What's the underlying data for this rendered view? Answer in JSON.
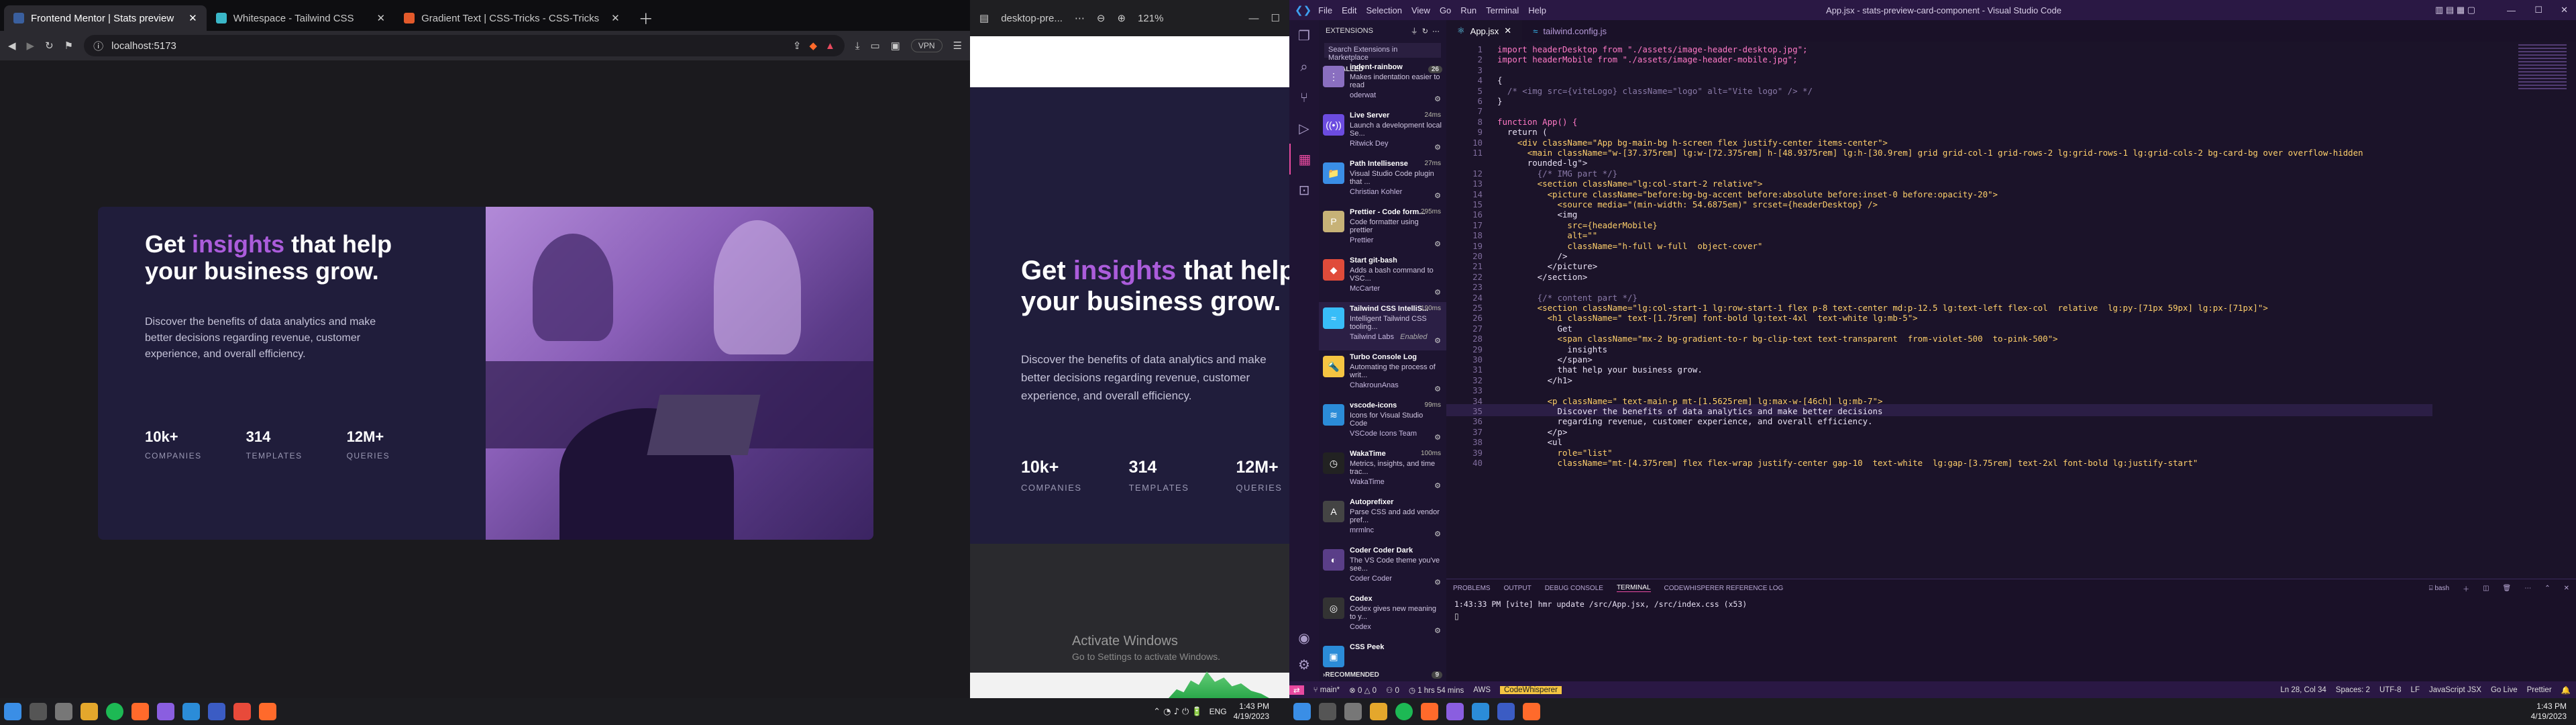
{
  "browser": {
    "tabs": [
      {
        "label": "Frontend Mentor | Stats preview"
      },
      {
        "label": "Whitespace - Tailwind CSS"
      },
      {
        "label": "Gradient Text | CSS-Tricks - CSS-Tricks"
      }
    ],
    "url": "localhost:5173",
    "vpn": "VPN"
  },
  "card_desktop": {
    "title_pre": "Get",
    "title_hl": "insights",
    "title_post": "that help your business grow.",
    "desc": "Discover the benefits of data analytics and make better decisions regarding revenue, customer experience, and overall efficiency.",
    "stats": [
      {
        "value": "10k+",
        "label": "COMPANIES"
      },
      {
        "value": "314",
        "label": "TEMPLATES"
      },
      {
        "value": "12M+",
        "label": "QUERIES"
      }
    ]
  },
  "browser2": {
    "url": "desktop-pre...",
    "zoom": "121%",
    "title_pre": "Get",
    "title_hl": "insights",
    "title_post1": "that help",
    "title_post2": "your business grow.",
    "desc": "Discover the benefits of data analytics and make better decisions regarding revenue, customer experience, and overall efficiency.",
    "stats": [
      {
        "value": "10k+",
        "label": "COMPANIES"
      },
      {
        "value": "314",
        "label": "TEMPLATES"
      },
      {
        "value": "12M+",
        "label": "QUERIES"
      }
    ],
    "activate_title": "Activate Windows",
    "activate_sub": "Go to Settings to activate Windows."
  },
  "vscode": {
    "menu": [
      "File",
      "Edit",
      "Selection",
      "View",
      "Go",
      "Run",
      "Terminal",
      "Help"
    ],
    "title": "App.jsx - stats-preview-card-component - Visual Studio Code",
    "sidebar_title": "EXTENSIONS",
    "search_placeholder": "Search Extensions in Marketplace",
    "installed_label": "INSTALLED",
    "installed_count": "26",
    "recommended_label": "RECOMMENDED",
    "recommended_count": "9",
    "extensions": [
      {
        "name": "indent-rainbow",
        "desc": "Makes indentation easier to read",
        "pub": "oderwat",
        "stat": ""
      },
      {
        "name": "Live Server",
        "desc": "Launch a development local Se...",
        "pub": "Ritwick Dey",
        "stat": "24ms"
      },
      {
        "name": "Path Intellisense",
        "desc": "Visual Studio Code plugin that ...",
        "pub": "Christian Kohler",
        "stat": "27ms"
      },
      {
        "name": "Prettier - Code form...",
        "desc": "Code formatter using prettier",
        "pub": "Prettier",
        "stat": "295ms"
      },
      {
        "name": "Start git-bash",
        "desc": "Adds a bash command to VSC...",
        "pub": "McCarter",
        "stat": ""
      },
      {
        "name": "Tailwind CSS IntelliS...",
        "desc": "Intelligent Tailwind CSS tooling...",
        "pub": "Tailwind Labs",
        "stat": "190ms"
      },
      {
        "name": "Turbo Console Log",
        "desc": "Automating the process of writ...",
        "pub": "ChakrounAnas",
        "stat": ""
      },
      {
        "name": "vscode-icons",
        "desc": "Icons for Visual Studio Code",
        "pub": "VSCode Icons Team",
        "stat": "99ms"
      },
      {
        "name": "WakaTime",
        "desc": "Metrics, insights, and time trac...",
        "pub": "WakaTime",
        "stat": "100ms"
      },
      {
        "name": "Autoprefixer",
        "desc": "Parse CSS and add vendor pref...",
        "pub": "mrmlnc",
        "stat": ""
      },
      {
        "name": "Coder Coder Dark",
        "desc": "The VS Code theme you've see...",
        "pub": "Coder Coder",
        "stat": ""
      },
      {
        "name": "Codex",
        "desc": "Codex gives new meaning to y...",
        "pub": "Codex",
        "stat": ""
      },
      {
        "name": "CSS Peek",
        "desc": "",
        "pub": "",
        "stat": ""
      }
    ],
    "tailwind_enabled": "Enabled",
    "tabs": [
      {
        "label": "App.jsx"
      },
      {
        "label": "tailwind.config.js"
      }
    ],
    "code_lines": [
      {
        "n": "1",
        "t": "import headerDesktop from \"./assets/image-header-desktop.jpg\";"
      },
      {
        "n": "2",
        "t": "import headerMobile from \"./assets/image-header-mobile.jpg\";"
      },
      {
        "n": "3",
        "t": ""
      },
      {
        "n": "4",
        "t": "{"
      },
      {
        "n": "5",
        "t": "  /* <img src={viteLogo} className=\"logo\" alt=\"Vite logo\" /> */"
      },
      {
        "n": "6",
        "t": "}"
      },
      {
        "n": "7",
        "t": ""
      },
      {
        "n": "8",
        "t": "function App() {"
      },
      {
        "n": "9",
        "t": "  return ("
      },
      {
        "n": "10",
        "t": "    <div className=\"App bg-main-bg h-screen flex justify-center items-center\">"
      },
      {
        "n": "11",
        "t": "      <main className=\"w-[37.375rem] lg:w-[72.375rem] h-[48.9375rem] lg:h-[30.9rem] grid grid-col-1 grid-rows-2 lg:grid-rows-1 lg:grid-cols-2 bg-card-bg over overflow-hidden"
      },
      {
        "n": "",
        "t": "      rounded-lg\">"
      },
      {
        "n": "12",
        "t": "        {/* IMG part */}"
      },
      {
        "n": "13",
        "t": "        <section className=\"lg:col-start-2 relative\">"
      },
      {
        "n": "14",
        "t": "          <picture className=\"before:bg-bg-accent before:absolute before:inset-0 before:opacity-20\">"
      },
      {
        "n": "15",
        "t": "            <source media=\"(min-width: 54.6875em)\" srcset={headerDesktop} />"
      },
      {
        "n": "16",
        "t": "            <img"
      },
      {
        "n": "17",
        "t": "              src={headerMobile}"
      },
      {
        "n": "18",
        "t": "              alt=\"\""
      },
      {
        "n": "19",
        "t": "              className=\"h-full w-full  object-cover\""
      },
      {
        "n": "20",
        "t": "            />"
      },
      {
        "n": "21",
        "t": "          </picture>"
      },
      {
        "n": "22",
        "t": "        </section>"
      },
      {
        "n": "23",
        "t": ""
      },
      {
        "n": "24",
        "t": "        {/* content part */}"
      },
      {
        "n": "25",
        "t": "        <section className=\"lg:col-start-1 lg:row-start-1 flex p-8 text-center md:p-12.5 lg:text-left flex-col  relative  lg:py-[71px 59px] lg:px-[71px]\">"
      },
      {
        "n": "26",
        "t": "          <h1 className=\" text-[1.75rem] font-bold lg:text-4xl  text-white lg:mb-5\">"
      },
      {
        "n": "27",
        "t": "            Get"
      },
      {
        "n": "28",
        "t": "            <span className=\"mx-2 bg-gradient-to-r bg-clip-text text-transparent  from-violet-500  to-pink-500\">"
      },
      {
        "n": "29",
        "t": "              insights"
      },
      {
        "n": "30",
        "t": "            </span>"
      },
      {
        "n": "31",
        "t": "            that help your business grow."
      },
      {
        "n": "32",
        "t": "          </h1>"
      },
      {
        "n": "33",
        "t": ""
      },
      {
        "n": "34",
        "t": "          <p className=\" text-main-p mt-[1.5625rem] lg:max-w-[46ch] lg:mb-7\">"
      },
      {
        "n": "35",
        "t": "            Discover the benefits of data analytics and make better decisions"
      },
      {
        "n": "36",
        "t": "            regarding revenue, customer experience, and overall efficiency."
      },
      {
        "n": "37",
        "t": "          </p>"
      },
      {
        "n": "38",
        "t": "          <ul"
      },
      {
        "n": "39",
        "t": "            role=\"list\""
      },
      {
        "n": "40",
        "t": "            className=\"mt-[4.375rem] flex flex-wrap justify-center gap-10  text-white  lg:gap-[3.75rem] text-2xl font-bold lg:justify-start\""
      }
    ],
    "panel_tabs": [
      "PROBLEMS",
      "OUTPUT",
      "DEBUG CONSOLE",
      "TERMINAL",
      "CODEWHISPERER REFERENCE LOG"
    ],
    "terminal_shell": "bash",
    "terminal_line": "1:43:33 PM [vite] hmr update /src/App.jsx, /src/index.css (x53)",
    "status_left": [
      "main*",
      "0 △ 0",
      "0",
      "1 hrs 54 mins",
      "AWS",
      "CodeWhisperer"
    ],
    "status_right": [
      "Ln 28, Col 34",
      "Spaces: 2",
      "UTF-8",
      "LF",
      "JavaScript JSX",
      "Go Live",
      "Prettier"
    ]
  },
  "taskbar_left": {
    "time": "1:43 PM",
    "date": "4/19/2023",
    "lang": "ENG"
  },
  "taskbar_right": {
    "time": "1:43 PM",
    "date": "4/19/2023"
  }
}
